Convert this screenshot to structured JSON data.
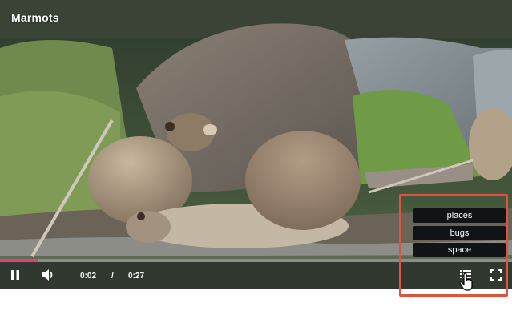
{
  "video": {
    "title": "Marmots",
    "progress_fraction": 0.074,
    "current_time": "0:02",
    "separator": "/",
    "duration": "0:27"
  },
  "chapters_menu": {
    "items": [
      {
        "label": "places"
      },
      {
        "label": "bugs"
      },
      {
        "label": "space"
      }
    ]
  },
  "icons": {
    "play_pause": "pause-icon",
    "volume": "volume-icon",
    "chapters": "chapters-list-icon",
    "fullscreen": "fullscreen-icon",
    "cursor": "hand-cursor-icon"
  },
  "colors": {
    "progress": "#e2407b",
    "highlight_border": "#e0533e",
    "menu_bg": "#111416"
  }
}
